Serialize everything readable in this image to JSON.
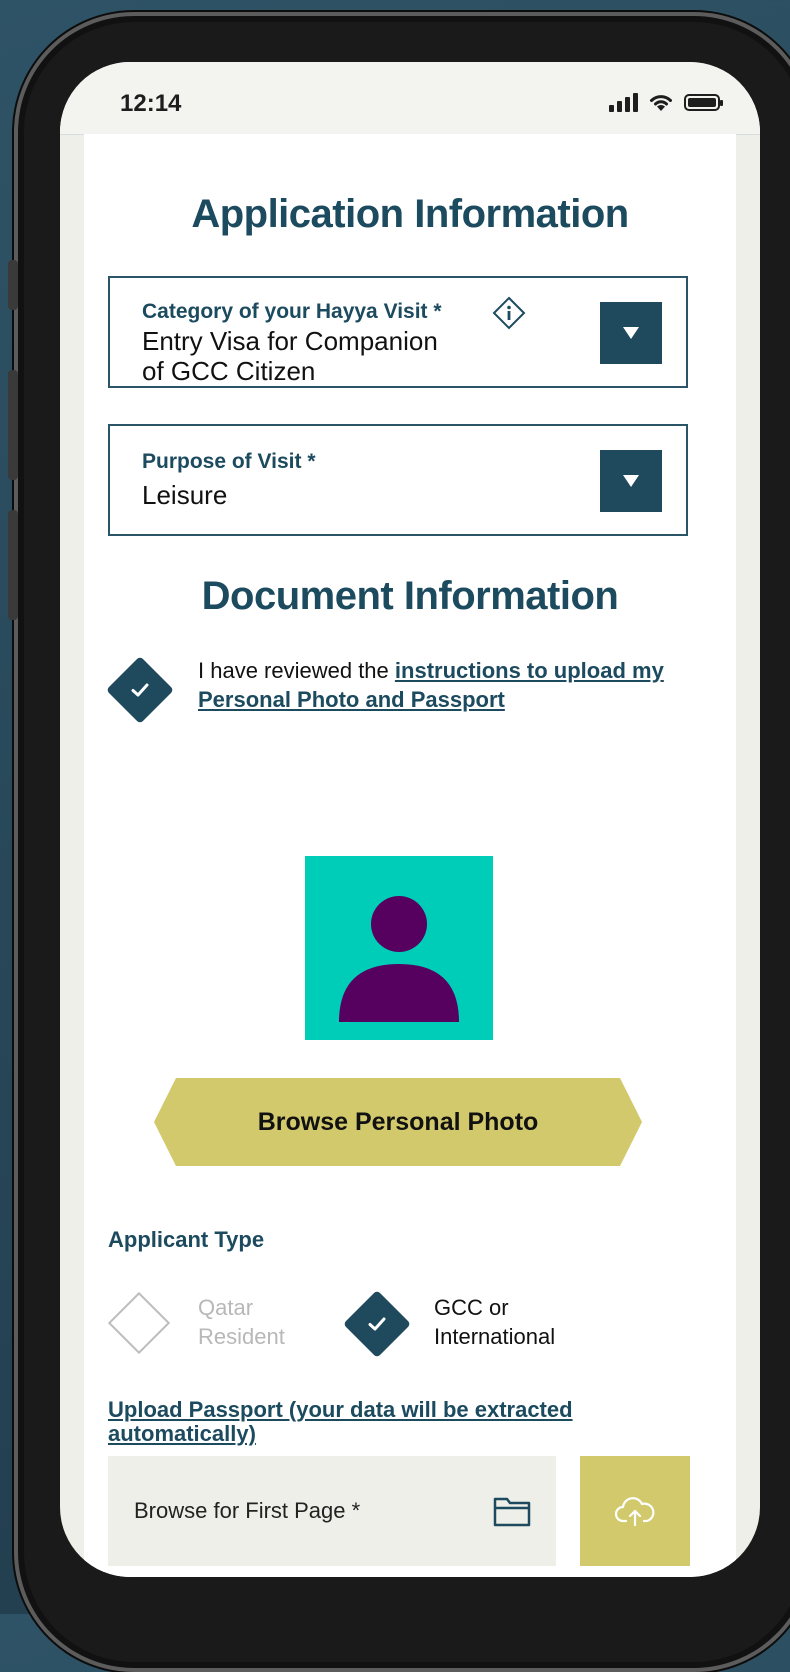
{
  "status_bar": {
    "time": "12:14"
  },
  "application_section": {
    "title": "Application Information",
    "category": {
      "label": "Category of your Hayya Visit *",
      "value_line1": "Entry Visa for Companion",
      "value_line2": "of GCC Citizen"
    },
    "purpose": {
      "label": "Purpose of Visit *",
      "value": "Leisure"
    }
  },
  "document_section": {
    "title": "Document Information",
    "acknowledgement": {
      "checked": true,
      "prefix": "I have reviewed the ",
      "link_text": "instructions to upload my Personal Photo and Passport"
    },
    "browse_photo_label": "Browse Personal Photo",
    "applicant_type": {
      "label": "Applicant Type",
      "options": [
        {
          "line1": "Qatar",
          "line2": "Resident",
          "selected": false
        },
        {
          "line1": "GCC or",
          "line2": "International",
          "selected": true
        }
      ]
    },
    "upload_passport_link": "Upload Passport (your data will be extracted automatically)",
    "first_page_placeholder": "Browse for First Page *"
  },
  "colors": {
    "primary": "#1f4a5e",
    "accent_gold": "#d2c96c",
    "photo_bg": "#00cdb8",
    "avatar": "#560060"
  }
}
